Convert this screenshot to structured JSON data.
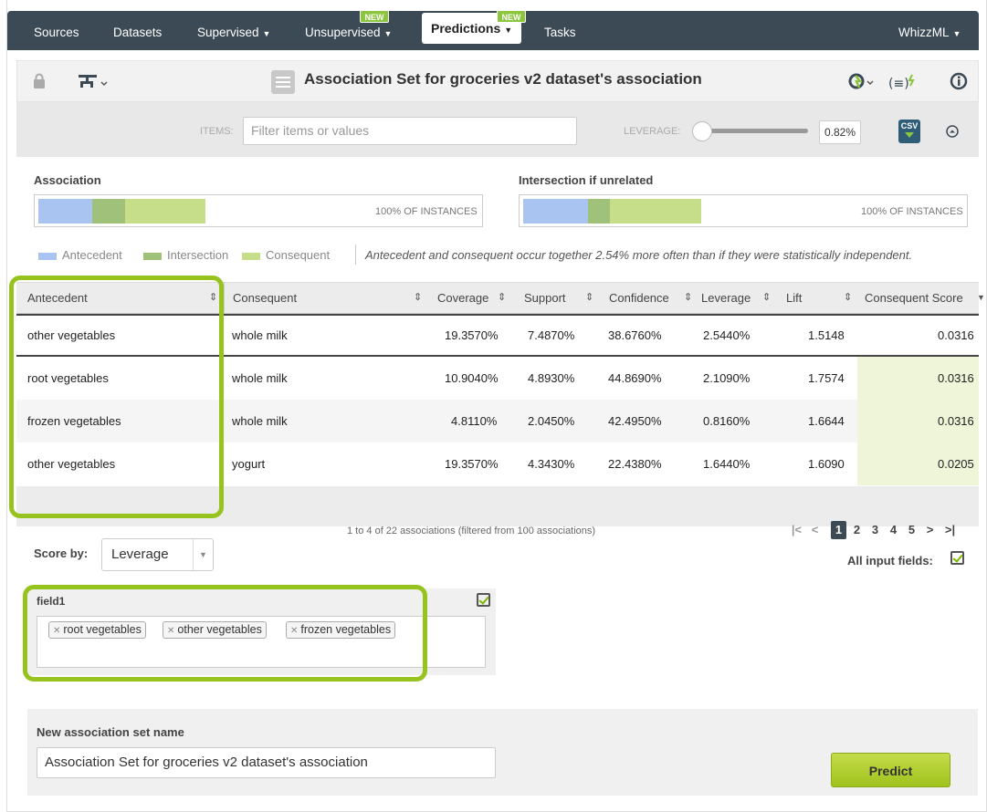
{
  "nav": {
    "items": [
      {
        "label": "Sources"
      },
      {
        "label": "Datasets"
      },
      {
        "label": "Supervised"
      },
      {
        "label": "Unsupervised"
      },
      {
        "label": "Predictions"
      },
      {
        "label": "Tasks"
      },
      {
        "label": "WhizzML"
      }
    ],
    "new_badge": "NEW"
  },
  "titlebar": {
    "title": "Association Set for groceries v2 dataset's association"
  },
  "filters": {
    "items_label": "ITEMS:",
    "items_placeholder": "Filter items or values",
    "leverage_label": "LEVERAGE:",
    "leverage_value": "0.82%",
    "csv_label": "CSV"
  },
  "bars": {
    "association_title": "Association",
    "association_caption": "100% OF INSTANCES",
    "intersection_title": "Intersection if unrelated",
    "intersection_caption": "100% OF INSTANCES"
  },
  "legend": {
    "antecedent": "Antecedent",
    "intersection": "Intersection",
    "consequent": "Consequent",
    "note": "Antecedent and consequent occur together 2.54% more often than if they were statistically independent."
  },
  "colors": {
    "antecedent": "#a9c4f0",
    "intersection": "#9fc17a",
    "consequent": "#c6dd8a",
    "accent": "#97c31e"
  },
  "table": {
    "headers": [
      "Antecedent",
      "Consequent",
      "Coverage",
      "Support",
      "Confidence",
      "Leverage",
      "Lift",
      "Consequent Score"
    ],
    "rows": [
      [
        "other vegetables",
        "whole milk",
        "19.3570%",
        "7.4870%",
        "38.6760%",
        "2.5440%",
        "1.5148",
        "0.0316"
      ],
      [
        "root vegetables",
        "whole milk",
        "10.9040%",
        "4.8930%",
        "44.8690%",
        "2.1090%",
        "1.7574",
        "0.0316"
      ],
      [
        "frozen vegetables",
        "whole milk",
        "4.8110%",
        "2.0450%",
        "42.4950%",
        "0.8160%",
        "1.6644",
        "0.0316"
      ],
      [
        "other vegetables",
        "yogurt",
        "19.3570%",
        "4.3430%",
        "22.4380%",
        "1.6440%",
        "1.6090",
        "0.0205"
      ]
    ],
    "pager_text": "1 to 4 of 22 associations (filtered from 100 associations)",
    "pages": [
      "1",
      "2",
      "3",
      "4",
      "5"
    ],
    "current_page": "1"
  },
  "score": {
    "label": "Score by:",
    "value": "Leverage",
    "all_fields_label": "All input fields:"
  },
  "field1": {
    "name": "field1",
    "tags": [
      "root vegetables",
      "other vegetables",
      "frozen vegetables"
    ]
  },
  "new_set": {
    "label": "New association set name",
    "value": "Association Set for groceries v2 dataset's association",
    "predict_label": "Predict"
  }
}
